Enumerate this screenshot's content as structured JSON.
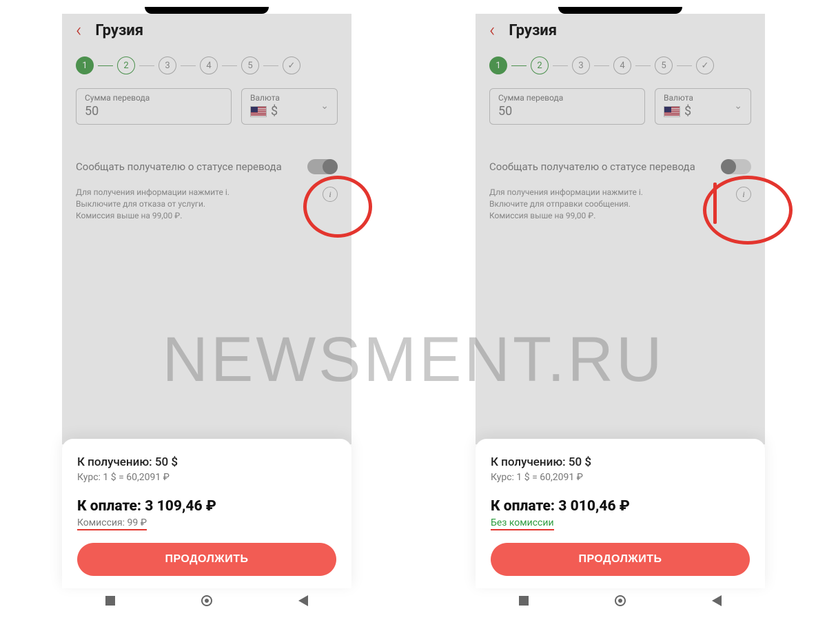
{
  "watermark": "NEWSMENT.RU",
  "left": {
    "title": "Грузия",
    "amount_label": "Сумма перевода",
    "amount_value": "50",
    "currency_label": "Валюта",
    "currency_symbol": "$",
    "toggle_label": "Сообщать получателю о статусе перевода",
    "toggle_state": "on",
    "info_text": "Для получения информации нажмите i.\nВыключите для отказа от услуги.\nКомиссия выше на 99,00 ₽.",
    "receive_label": "К получению: 50 $",
    "rate_label": "Курс: 1 $ = 60,2091 ₽",
    "total_label": "К оплате: 3 109,46 ₽",
    "fee_label": "Комиссия: 99 ₽",
    "continue_label": "ПРОДОЛЖИТЬ"
  },
  "right": {
    "title": "Грузия",
    "amount_label": "Сумма перевода",
    "amount_value": "50",
    "currency_label": "Валюта",
    "currency_symbol": "$",
    "toggle_label": "Сообщать получателю о статусе перевода",
    "toggle_state": "off",
    "info_text": "Для получения информации нажмите i.\nВключите для отправки сообщения.\nКомиссия выше на 99,00 ₽.",
    "receive_label": "К получению: 50 $",
    "rate_label": "Курс: 1 $ = 60,2091 ₽",
    "total_label": "К оплате: 3 010,46 ₽",
    "fee_label": "Без комиссии",
    "continue_label": "ПРОДОЛЖИТЬ"
  },
  "steps": [
    "1",
    "2",
    "3",
    "4",
    "5"
  ]
}
